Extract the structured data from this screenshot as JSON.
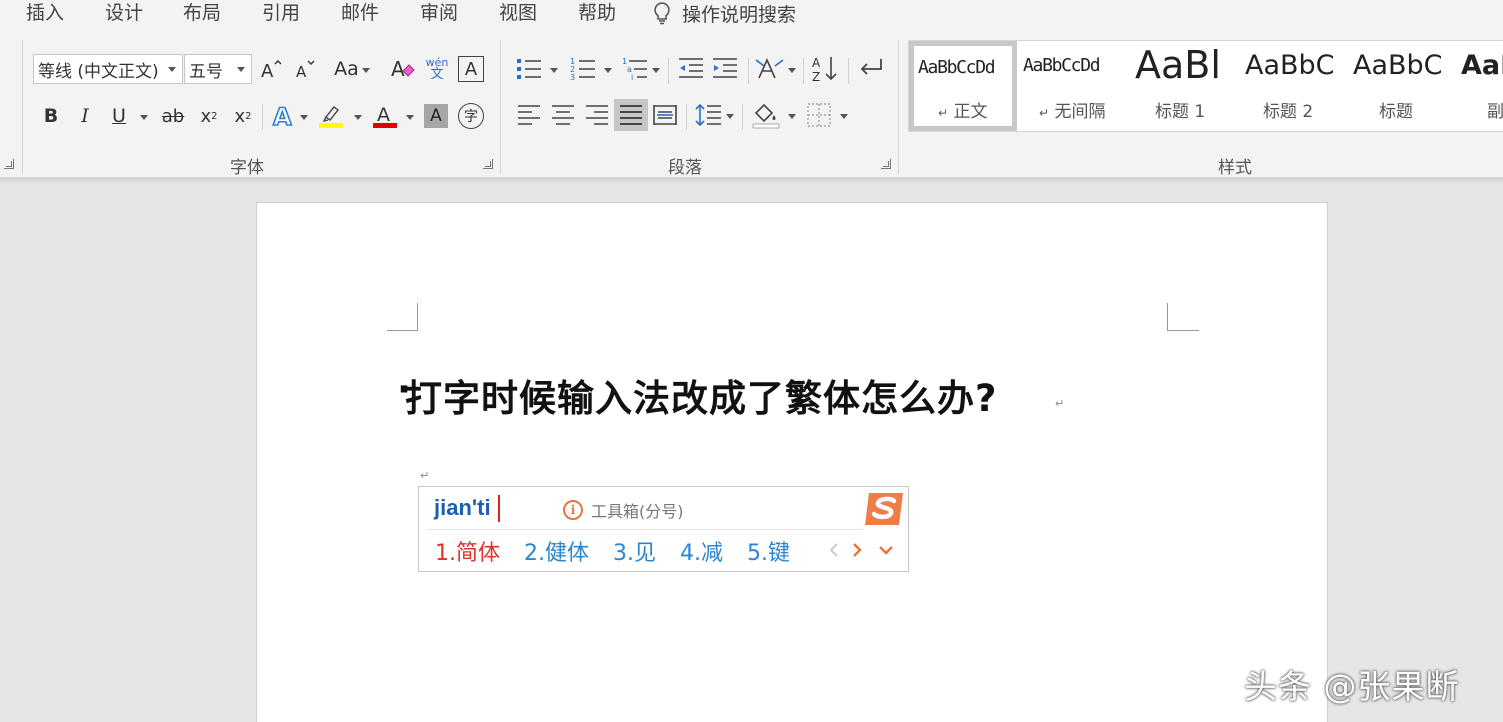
{
  "menu": {
    "items": [
      "插入",
      "设计",
      "布局",
      "引用",
      "邮件",
      "审阅",
      "视图",
      "帮助"
    ],
    "tellme": "操作说明搜索"
  },
  "ribbon": {
    "font_group": {
      "label": "字体",
      "font_name": "等线 (中文正文)",
      "font_size": "五号",
      "change_case": "Aa",
      "phonetic_top": "wén",
      "phonetic_bottom": "文",
      "bold": "B",
      "italic": "I",
      "underline": "U",
      "strike": "ab",
      "subscript": "x",
      "subscript_mark": "2",
      "superscript": "x",
      "superscript_mark": "2",
      "font_color_letter": "A",
      "enclose_char": "字",
      "colors": {
        "highlight": "#ffff00",
        "font_color": "#e00000",
        "shading": "#a6a6a6"
      }
    },
    "paragraph_group": {
      "label": "段落"
    },
    "styles_group": {
      "label": "样式",
      "styles": [
        {
          "sample": "AaBbCcDd",
          "name": "正文",
          "mark": "↵",
          "selected": true
        },
        {
          "sample": "AaBbCcDd",
          "name": "无间隔",
          "mark": "↵",
          "selected": false
        },
        {
          "sample": "AaBl",
          "name": "标题 1",
          "mark": "",
          "selected": false
        },
        {
          "sample": "AaBbC",
          "name": "标题 2",
          "mark": "",
          "selected": false
        },
        {
          "sample": "AaBbC",
          "name": "标题",
          "mark": "",
          "selected": false
        },
        {
          "sample": "AaI",
          "name": "副标",
          "mark": "",
          "selected": false
        }
      ]
    }
  },
  "document": {
    "bullet": "·",
    "heading": "打字时候输入法改成了繁体怎么办?",
    "para_mark": "↵"
  },
  "ime": {
    "pinyin": "jian'ti",
    "toolbox": "工具箱(分号)",
    "info_icon": "i",
    "candidates": [
      "1.简体",
      "2.健体",
      "3.见",
      "4.减",
      "5.键"
    ],
    "colors": {
      "pinyin": "#1a5fb4",
      "first": "#e0312b",
      "others": "#2a86d1",
      "accent": "#e8743b"
    }
  },
  "watermark": "头条 @张果断"
}
